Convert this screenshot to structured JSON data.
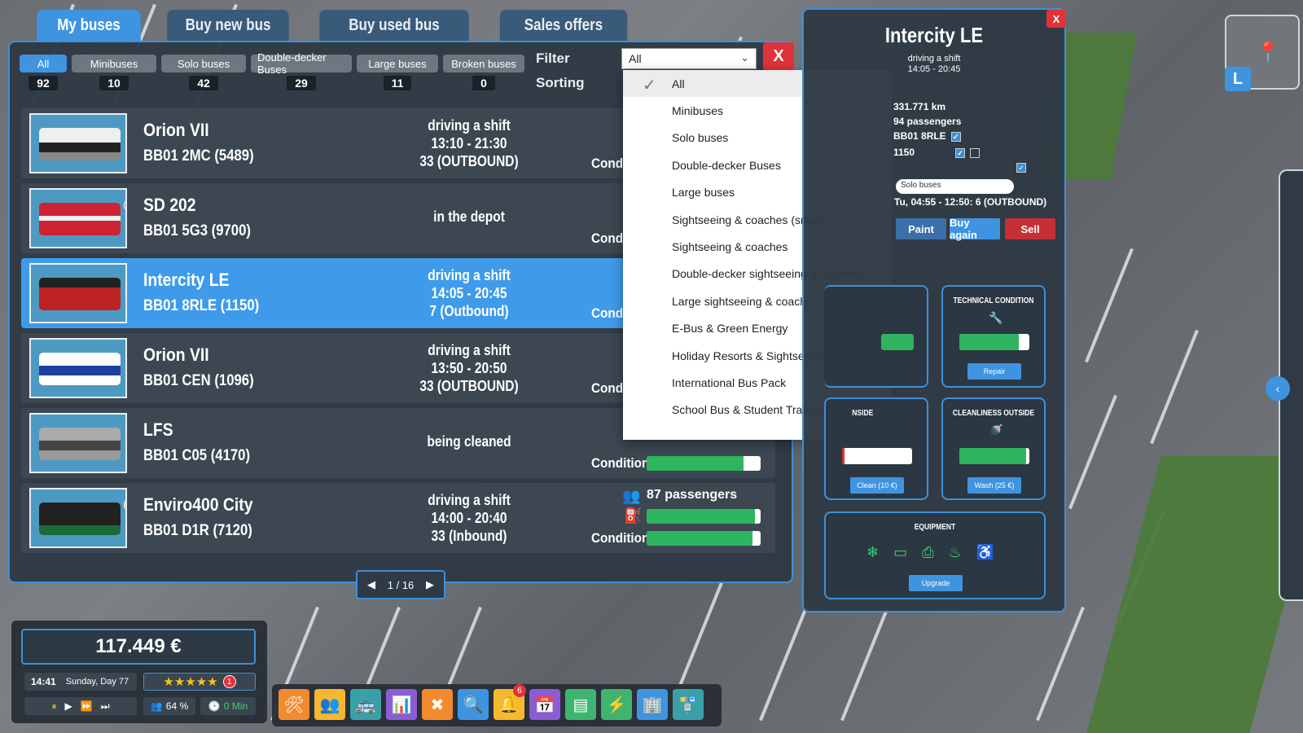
{
  "tabs": [
    {
      "label": "My buses",
      "active": true
    },
    {
      "label": "Buy new bus",
      "active": false
    },
    {
      "label": "Buy used bus",
      "active": false
    },
    {
      "label": "Sales offers",
      "active": false
    }
  ],
  "filters": [
    {
      "label": "All",
      "count": "92",
      "active": true
    },
    {
      "label": "Minibuses",
      "count": "10"
    },
    {
      "label": "Solo buses",
      "count": "42"
    },
    {
      "label": "Double-decker Buses",
      "count": "29"
    },
    {
      "label": "Large buses",
      "count": "11"
    },
    {
      "label": "Broken buses",
      "count": "0"
    }
  ],
  "filter_label": "Filter",
  "sorting_label": "Sorting",
  "filter_select": {
    "value": "All"
  },
  "close_x": "X",
  "buses": [
    {
      "name": "Orion VII",
      "plate": "BB01 2MC (5489)",
      "status": "driving a shift\n13:10 - 21:30\n33 (OUTBOUND)",
      "condition_label": "Condi"
    },
    {
      "name": "SD 202",
      "plate": "BB01 5G3 (9700)",
      "status": "in the depot",
      "condition_label": "Condi"
    },
    {
      "name": "Intercity LE",
      "plate": "BB01 8RLE (1150)",
      "status": "driving a shift\n14:05 - 20:45\n7 (Outbound)",
      "condition_label": "Condi",
      "selected": true
    },
    {
      "name": "Orion VII",
      "plate": "BB01 CEN (1096)",
      "status": "driving a shift\n13:50 - 20:50\n33 (OUTBOUND)",
      "condition_label": "Condi"
    },
    {
      "name": "LFS",
      "plate": "BB01 C05 (4170)",
      "status": "being cleaned",
      "condition_label": "Condition",
      "cond_value": 0.85
    },
    {
      "name": "Enviro400 City",
      "plate": "BB01 D1R (7120)",
      "status": "driving a shift\n14:00 - 20:40\n33 (Inbound)",
      "condition_label": "Condition",
      "passengers": "87 passengers",
      "fill_value": 0.95,
      "cond_value": 0.93
    }
  ],
  "dropdown_options": [
    "All",
    "Minibuses",
    "Solo buses",
    "Double-decker Buses",
    "Large buses",
    "Sightseeing & coaches (small)",
    "Sightseeing & coaches",
    "Double-decker sightseeing & coaches",
    "Large sightseeing & coaches",
    "E-Bus & Green Energy",
    "Holiday Resorts & Sightseeing Buses",
    "International Bus Pack",
    "School Bus & Student Transportation"
  ],
  "pager": {
    "text": "1 / 16"
  },
  "detail": {
    "title": "Intercity LE",
    "subtitle": "driving a shift\n14:05 - 20:45",
    "km": "331.771 km",
    "passengers": "94 passengers",
    "plate": "BB01 8RLE",
    "number": "1150",
    "type_select": "Solo buses",
    "schedule": "Tu, 04:55 - 12:50: 6 (OUTBOUND)",
    "paint": "Paint",
    "buy_again": "Buy again",
    "sell": "Sell",
    "technical_title": "TECHNICAL CONDITION",
    "technical_value": 0.85,
    "repair": "Repair",
    "inside_title": "NSIDE",
    "inside_value": 0.03,
    "clean": "Clean (10 €)",
    "outside_title": "CLEANLINESS OUTSIDE",
    "outside_value": 0.95,
    "wash": "Wash (25 €)",
    "equipment_title": "EQUIPMENT",
    "upgrade": "Upgrade",
    "close": "X"
  },
  "status_bar": {
    "money": "117.449 €",
    "time": "14:41",
    "day": "Sunday, Day 77",
    "stars": "★★★★★",
    "alert": "1",
    "satisfaction": "64 %",
    "delay": "0 Min"
  },
  "toolbar_badge": "6",
  "colors": {
    "accent": "#3f94e0",
    "danger": "#e0323a",
    "good": "#2fb45f",
    "panel": "#2f3a44"
  }
}
